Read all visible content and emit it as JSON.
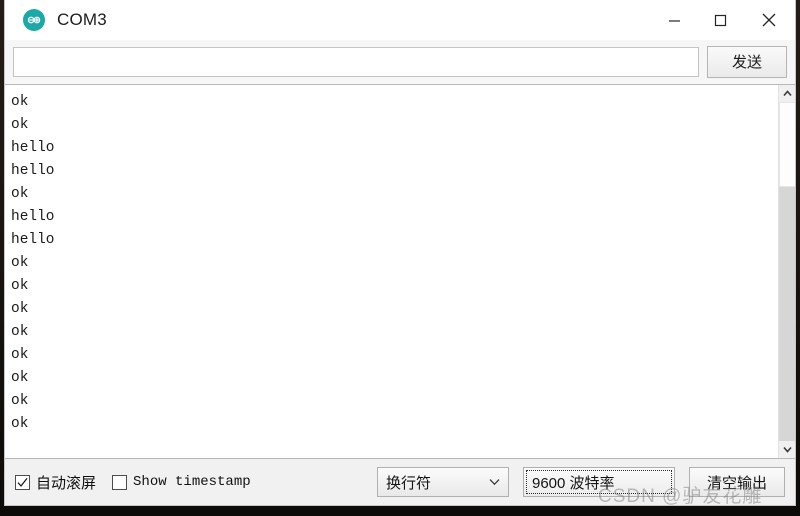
{
  "window": {
    "title": "COM3",
    "app_icon": "arduino-logo-icon",
    "controls": {
      "minimize": "minimize-icon",
      "maximize": "maximize-icon",
      "close": "close-icon"
    }
  },
  "send_row": {
    "input_value": "",
    "input_placeholder": "",
    "send_label": "发送"
  },
  "console": {
    "lines": [
      "ok",
      "ok",
      "hello",
      "hello",
      "ok",
      "hello",
      "hello",
      "ok",
      "ok",
      "ok",
      "ok",
      "ok",
      "ok",
      "ok",
      "ok"
    ]
  },
  "scrollbar": {
    "up_icon": "chevron-up-icon",
    "down_icon": "chevron-down-icon",
    "thumb_top_pct": 0,
    "thumb_height_pct": 25
  },
  "status_bar": {
    "autoscroll": {
      "label": "自动滚屏",
      "checked": true
    },
    "show_timestamp": {
      "label": "Show timestamp",
      "checked": false
    },
    "newline_select": {
      "value": "换行符",
      "icon": "chevron-down-icon"
    },
    "baud_select": {
      "value": "9600 波特率",
      "focused": true
    },
    "clear_button": {
      "label": "清空输出"
    }
  },
  "watermark": {
    "text": "CSDN @驴友花雕"
  },
  "colors": {
    "accent": "#1aa8a8",
    "window_bg": "#ffffff",
    "statusbar_bg": "#f1f1f1",
    "text": "#1b1b1b"
  }
}
